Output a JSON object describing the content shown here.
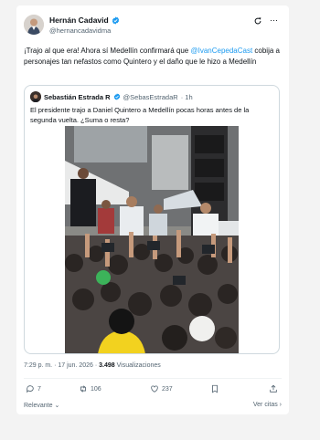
{
  "post": {
    "author_name": "Hernán Cadavid",
    "author_handle": "@hernancadavidma",
    "text_before": "¡Trajo al que era! Ahora sí Medellín confirmará que ",
    "mention": "@IvanCepedaCast",
    "text_after": " cobija a personajes tan nefastos como Quintero y el daño que le hizo a Medellín"
  },
  "quote": {
    "author_name": "Sebastián Estrada R",
    "author_handle": "@SebasEstradaR",
    "time": "· 1h",
    "text": "El presidente trajo a Daniel Quintero a Medellín pocas horas antes de la segunda vuelta. ¿Suma o resta?"
  },
  "meta": {
    "time": "7:29 p. m.",
    "date": "· 17 jun. 2026 ·",
    "views_count": "3.498",
    "views_label": "Visualizaciones"
  },
  "actions": {
    "replies": "7",
    "reposts": "106",
    "likes": "237"
  },
  "footer": {
    "sort_label": "Relevante ⌄",
    "quotes_link": "Ver citas ›"
  },
  "icons": {
    "verified": "verified-badge-icon",
    "grok": "grok-icon",
    "more": "more-icon",
    "reply": "reply-icon",
    "repost": "repost-icon",
    "like": "like-icon",
    "bookmark": "bookmark-icon",
    "share": "share-icon"
  },
  "colors": {
    "accent": "#1d9bf0",
    "muted": "#536471",
    "text": "#0f1419",
    "verified": "#1d9bf0"
  }
}
